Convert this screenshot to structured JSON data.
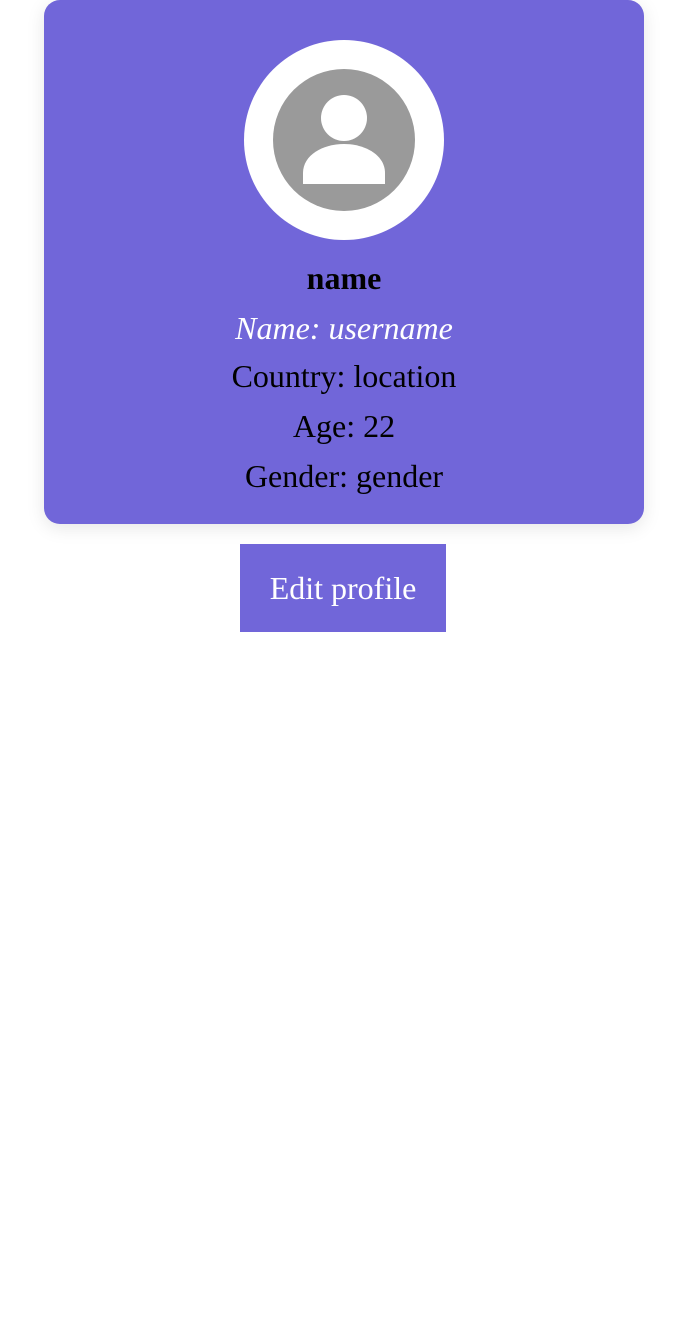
{
  "colors": {
    "accent": "#7166d9",
    "avatar_bg": "#9a9a9a",
    "avatar_ring": "#ffffff"
  },
  "profile": {
    "avatar_icon": "user-silhouette-icon",
    "title": "name",
    "username_line": "Name: username",
    "country_line": "Country: location",
    "age_line": "Age: 22",
    "gender_line": "Gender: gender"
  },
  "actions": {
    "edit_label": "Edit profile"
  }
}
